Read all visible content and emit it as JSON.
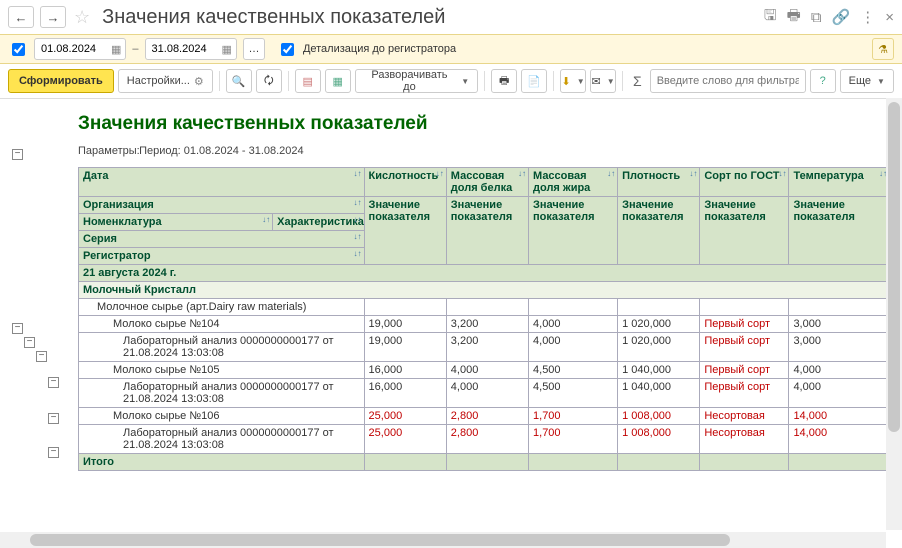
{
  "window": {
    "title": "Значения качественных показателей"
  },
  "filter": {
    "date_from": "01.08.2024",
    "date_to": "31.08.2024",
    "detail_label": "Детализация до регистратора"
  },
  "toolbar": {
    "form_label": "Сформировать",
    "settings_label": "Настройки...",
    "expand_label": "Разворачивать до",
    "filter_placeholder": "Введите слово для фильтра (название товара, покупате...",
    "more_label": "Еще"
  },
  "report": {
    "title": "Значения качественных показателей",
    "params_label": "Параметры:",
    "period_label": "Период: 01.08.2024 - 31.08.2024",
    "headers": {
      "date": "Дата",
      "acidity": "Кислотность",
      "protein": "Массовая доля белка",
      "fat": "Массовая доля жира",
      "density": "Плотность",
      "gost": "Сорт по ГОСТ",
      "temp": "Температура",
      "org": "Организация",
      "value": "Значение показателя",
      "value2": "Значение показателя",
      "value3": "Значение показателя",
      "value4": "Значение показателя",
      "value5": "Значение показателя",
      "value6": "Значение показателя",
      "nomen": "Номенклатура",
      "char": "Характеристика",
      "series": "Серия",
      "registr": "Регистратор"
    },
    "group_date": "21 августа 2024 г.",
    "group_org": "Молочный Кристалл",
    "group_nom": "Молочное сырье (арт.Dairy raw materials)",
    "rows": [
      {
        "name": "Молоко сырье №104",
        "reg": "Лабораторный анализ 0000000000177 от 21.08.2024 13:03:08",
        "acidity": "19,000",
        "protein": "3,200",
        "fat": "4,000",
        "density": "1 020,000",
        "gost": "Первый сорт",
        "temp": "3,000",
        "red": false
      },
      {
        "name": "Молоко сырье №105",
        "reg": "Лабораторный анализ 0000000000177 от 21.08.2024 13:03:08",
        "acidity": "16,000",
        "protein": "4,000",
        "fat": "4,500",
        "density": "1 040,000",
        "gost": "Первый сорт",
        "temp": "4,000",
        "red": false
      },
      {
        "name": "Молоко сырье №106",
        "reg": "Лабораторный анализ 0000000000177 от 21.08.2024 13:03:08",
        "acidity": "25,000",
        "protein": "2,800",
        "fat": "1,700",
        "density": "1 008,000",
        "gost": "Несортовая",
        "temp": "14,000",
        "red": true
      }
    ],
    "total_label": "Итого"
  }
}
